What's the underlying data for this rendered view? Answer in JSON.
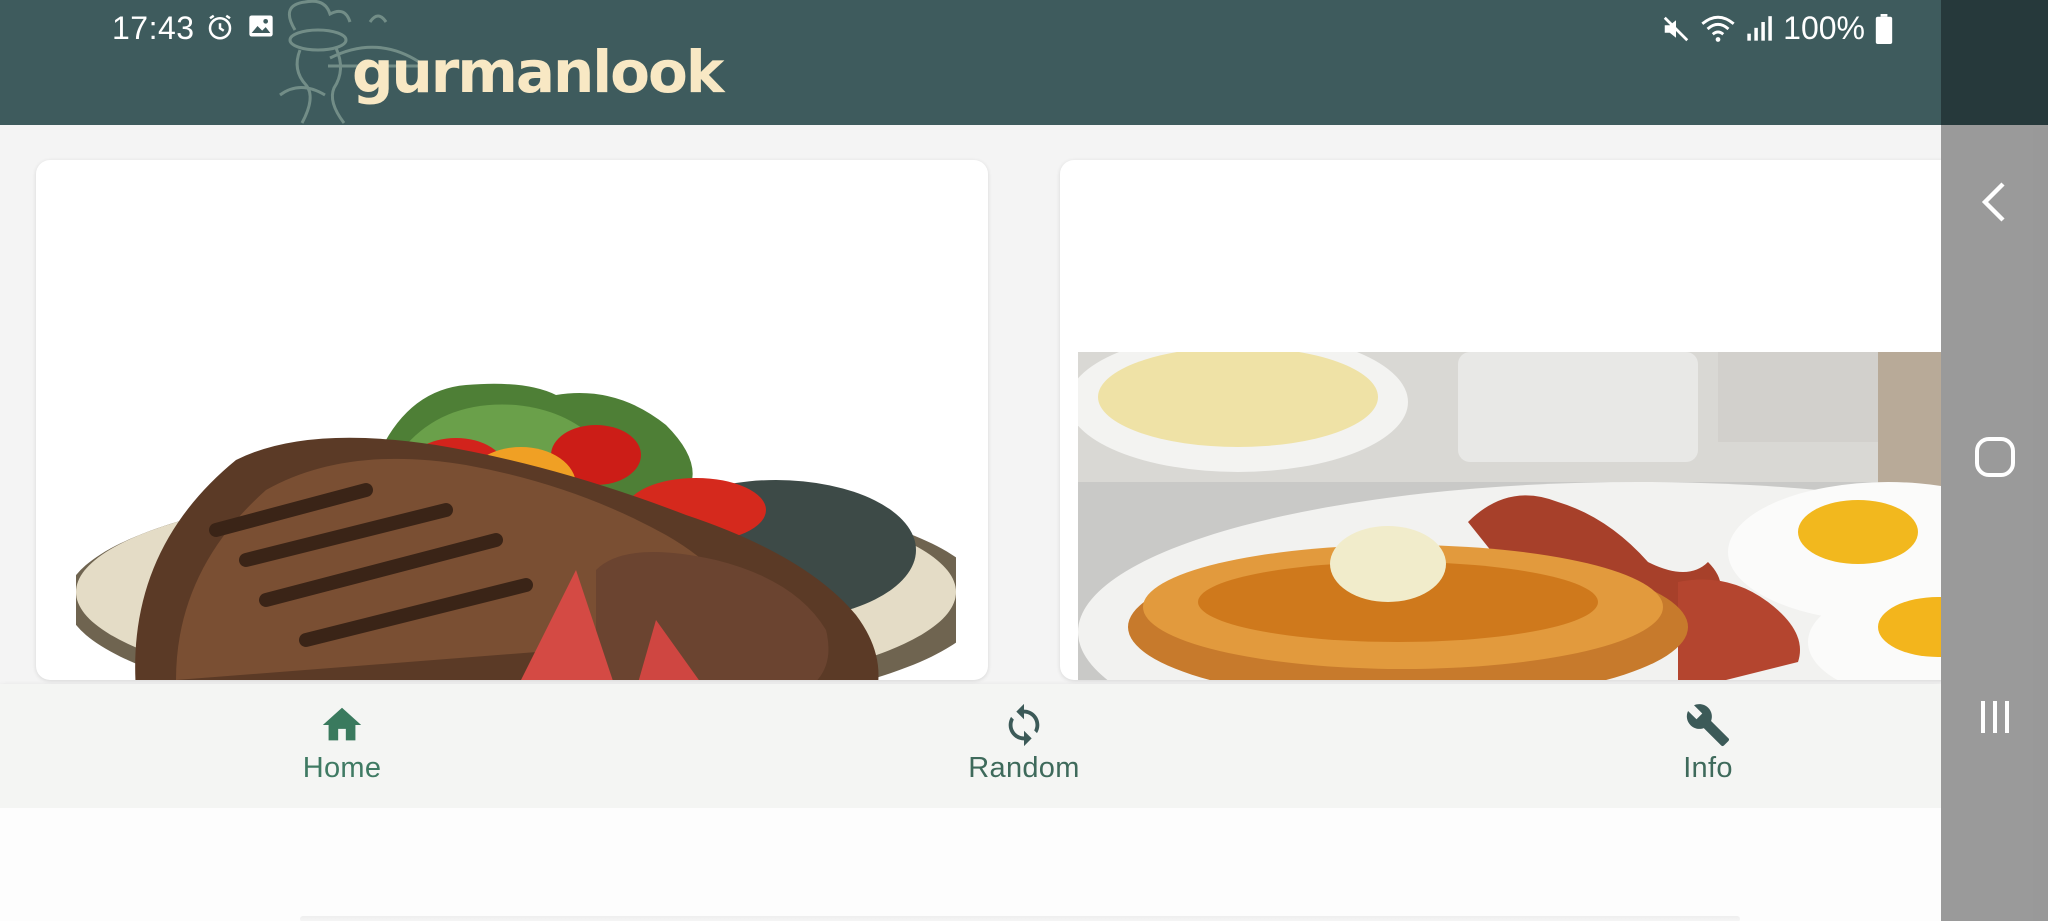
{
  "status_bar": {
    "time": "17:43",
    "battery": "100%"
  },
  "app": {
    "logo_text": "gurmanlook",
    "theme_color": "#3e5b5d",
    "accent_color": "#3f7a63"
  },
  "cards": [
    {
      "image": "steak-with-salad"
    },
    {
      "image": "pancakes-bacon-eggs"
    }
  ],
  "bottom_nav": {
    "items": [
      {
        "label": "Home",
        "icon": "home-icon"
      },
      {
        "label": "Random",
        "icon": "refresh-icon"
      },
      {
        "label": "Info",
        "icon": "wrench-icon"
      }
    ]
  },
  "system_nav": {
    "buttons": [
      "back-icon",
      "home-circle-icon",
      "recents-icon"
    ]
  }
}
